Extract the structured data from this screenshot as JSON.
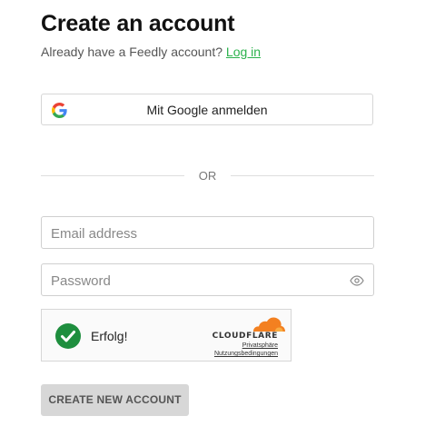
{
  "page": {
    "title": "Create an account",
    "subtitle_text": "Already have a Feedly account?",
    "login_link": "Log in",
    "accent_color": "#2bb24c"
  },
  "google": {
    "label": "Mit Google anmelden",
    "icon": "google-g-icon"
  },
  "divider": {
    "text": "OR"
  },
  "email": {
    "placeholder": "Email address",
    "value": ""
  },
  "password": {
    "placeholder": "Password",
    "value": "",
    "toggle_icon": "eye-icon"
  },
  "captcha": {
    "status": "Erfolg!",
    "status_color": "#1e8e3e",
    "brand": "CLOUDFLARE",
    "privacy_link": "Privatsphäre",
    "terms_link": "Nutzungsbedingungen",
    "brand_color": "#f38020"
  },
  "submit": {
    "label": "CREATE NEW ACCOUNT",
    "disabled": true
  }
}
